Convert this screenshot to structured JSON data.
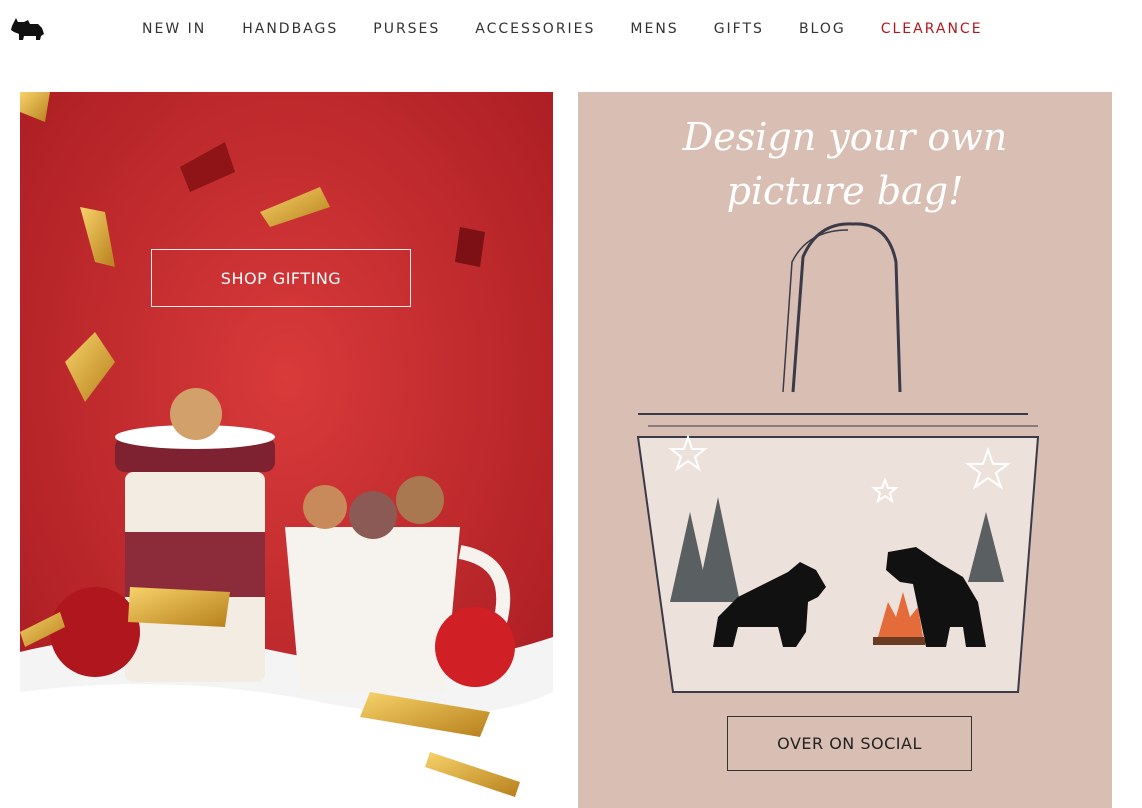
{
  "header": {
    "logo_icon": "scottie-dog-logo-icon",
    "nav": [
      {
        "label": "NEW IN"
      },
      {
        "label": "HANDBAGS"
      },
      {
        "label": "PURSES"
      },
      {
        "label": "ACCESSORIES"
      },
      {
        "label": "MENS"
      },
      {
        "label": "GIFTS"
      },
      {
        "label": "BLOG"
      },
      {
        "label": "CLEARANCE",
        "color": "#b3161c"
      }
    ]
  },
  "promos": {
    "gifting": {
      "cta_label": "SHOP GIFTING",
      "background": "#c8272c"
    },
    "social": {
      "title_line1": "Design your own",
      "title_line2": "picture bag!",
      "cta_label": "OVER ON SOCIAL",
      "background": "#d9bfb3"
    }
  }
}
